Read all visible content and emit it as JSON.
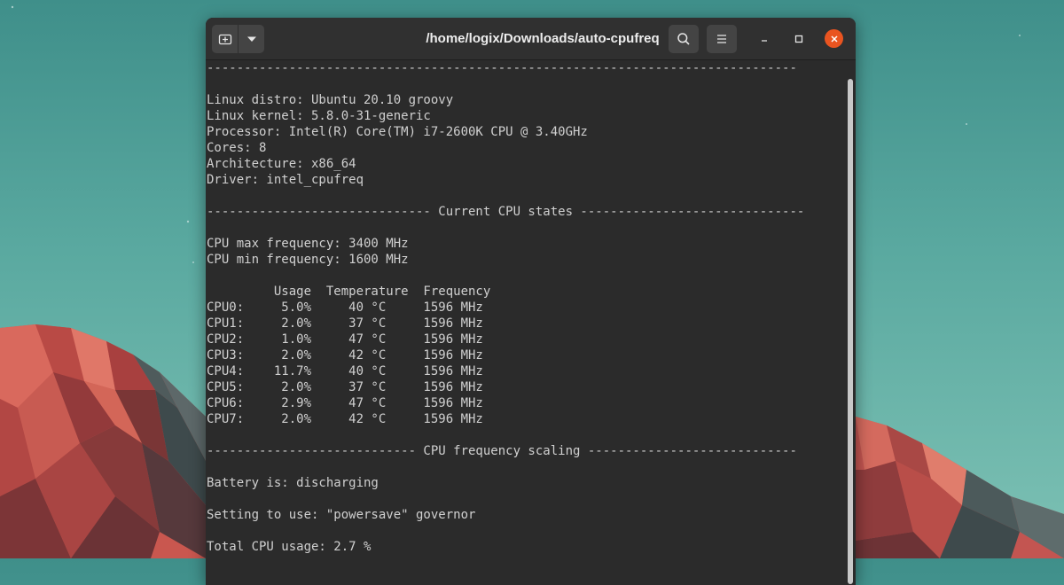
{
  "window": {
    "title": "/home/logix/Downloads/auto-cpufreq"
  },
  "icons": {
    "new_tab": "new-tab-icon",
    "dropdown": "chevron-down-icon",
    "search": "search-icon",
    "menu": "hamburger-menu-icon",
    "minimize": "minimize-icon",
    "maximize": "maximize-icon",
    "close": "close-icon"
  },
  "colors": {
    "close_button": "#e95420",
    "terminal_bg": "#2b2b2b",
    "terminal_text": "#d0d0d0"
  },
  "terminal": {
    "lines": [
      "-------------------------------------------------------------------------------",
      "",
      "Linux distro: Ubuntu 20.10 groovy",
      "Linux kernel: 5.8.0-31-generic",
      "Processor: Intel(R) Core(TM) i7-2600K CPU @ 3.40GHz",
      "Cores: 8",
      "Architecture: x86_64",
      "Driver: intel_cpufreq",
      "",
      "------------------------------ Current CPU states ------------------------------",
      "",
      "CPU max frequency: 3400 MHz",
      "CPU min frequency: 1600 MHz",
      "",
      "         Usage  Temperature  Frequency",
      "CPU0:     5.0%     40 °C     1596 MHz",
      "CPU1:     2.0%     37 °C     1596 MHz",
      "CPU2:     1.0%     47 °C     1596 MHz",
      "CPU3:     2.0%     42 °C     1596 MHz",
      "CPU4:    11.7%     40 °C     1596 MHz",
      "CPU5:     2.0%     37 °C     1596 MHz",
      "CPU6:     2.9%     47 °C     1596 MHz",
      "CPU7:     2.0%     42 °C     1596 MHz",
      "",
      "---------------------------- CPU frequency scaling ----------------------------",
      "",
      "Battery is: discharging",
      "",
      "Setting to use: \"powersave\" governor",
      "",
      "Total CPU usage: 2.7 %"
    ]
  }
}
